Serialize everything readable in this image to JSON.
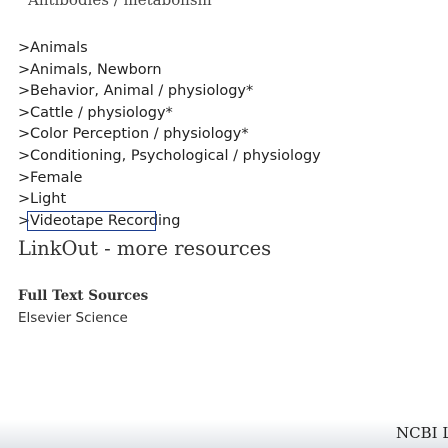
{
  "top_cutoff_text": "Antibodies / metabolism",
  "mesh_terms": [
    "Animals",
    "Animals, Newborn",
    "Behavior, Animal / physiology*",
    "Cattle / physiology*",
    "Color Perception / physiology*",
    "Conditioning, Psychological / physiology",
    "Female",
    "Light",
    "Videotape Recording"
  ],
  "chevron": ">",
  "linkout": {
    "title": "LinkOut - more resources",
    "full_text_heading": "Full Text Sources",
    "providers": [
      "Elsevier Science"
    ]
  },
  "footer": {
    "brand_cutoff": "NCBI Lit"
  }
}
